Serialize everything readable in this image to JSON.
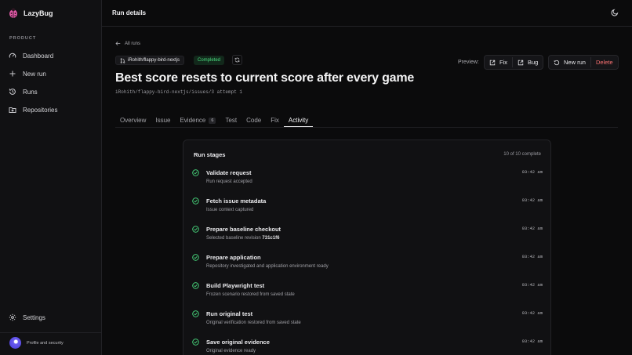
{
  "app": {
    "name": "LazyBug"
  },
  "sidebar": {
    "section_label": "PRODUCT",
    "items": [
      {
        "label": "Dashboard",
        "icon": "gauge-icon"
      },
      {
        "label": "New run",
        "icon": "plus-icon"
      },
      {
        "label": "Runs",
        "icon": "history-icon"
      },
      {
        "label": "Repositories",
        "icon": "folder-git-icon"
      }
    ],
    "settings_label": "Settings",
    "profile_label": "Profile and security"
  },
  "topbar": {
    "title": "Run details"
  },
  "run": {
    "back_label": "All runs",
    "repo": "iRohith/flappy-bird-nextjs",
    "status": "Completed",
    "title": "Best score resets to current score after every game",
    "issue_path": "iRohith/flappy-bird-nextjs/issues/3 attempt 1"
  },
  "preview": {
    "label": "Preview:",
    "fix_label": "Fix",
    "bug_label": "Bug"
  },
  "actions": {
    "new_run_label": "New run",
    "delete_label": "Delete"
  },
  "tabs": [
    {
      "label": "Overview"
    },
    {
      "label": "Issue"
    },
    {
      "label": "Evidence",
      "count": "6"
    },
    {
      "label": "Test"
    },
    {
      "label": "Code"
    },
    {
      "label": "Fix"
    },
    {
      "label": "Activity",
      "active": true
    }
  ],
  "stages": {
    "title": "Run stages",
    "count": "10 of 10 complete",
    "items": [
      {
        "name": "Validate request",
        "desc": "Run request accepted",
        "time": "03:42 am"
      },
      {
        "name": "Fetch issue metadata",
        "desc": "Issue context captured",
        "time": "03:42 am"
      },
      {
        "name": "Prepare baseline checkout",
        "desc": "Selected baseline revision",
        "desc_bold": "731c1f6",
        "time": "03:42 am"
      },
      {
        "name": "Prepare application",
        "desc": "Repository investigated and application environment ready",
        "time": "03:42 am"
      },
      {
        "name": "Build Playwright test",
        "desc": "Frozen scenario restored from saved state",
        "time": "03:42 am"
      },
      {
        "name": "Run original test",
        "desc": "Original verification restored from saved state",
        "time": "03:42 am"
      },
      {
        "name": "Save original evidence",
        "desc": "Original evidence ready",
        "time": "03:42 am"
      }
    ]
  },
  "colors": {
    "success": "#4ade80",
    "danger": "#f87171",
    "brand": "#e879b9"
  }
}
